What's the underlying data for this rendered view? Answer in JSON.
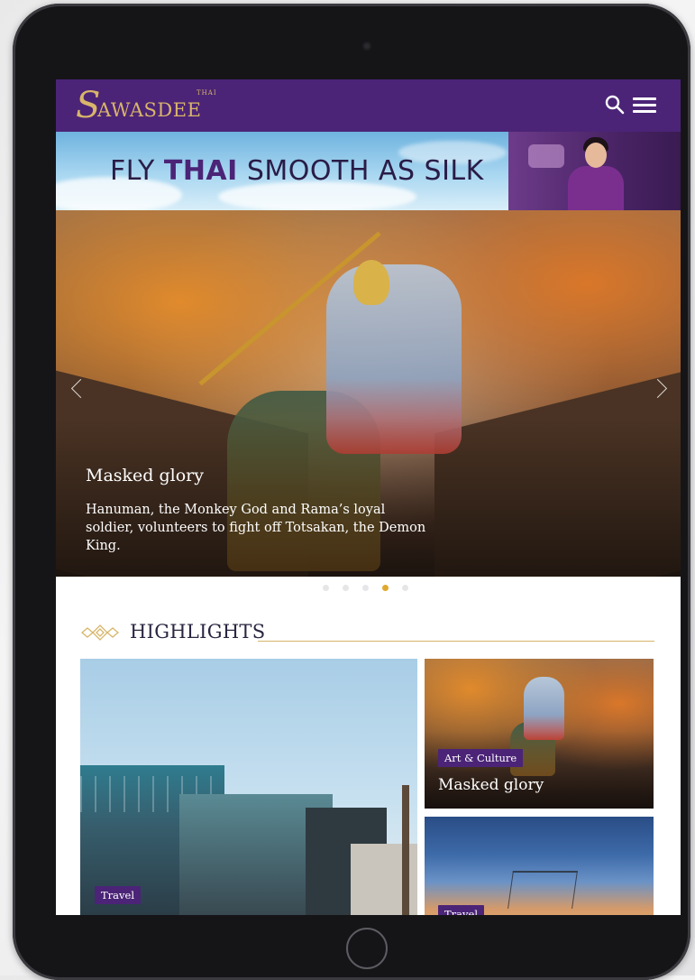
{
  "header": {
    "logo_initial": "S",
    "logo_text": "AWASDEE",
    "logo_tag": "THAI"
  },
  "banner": {
    "text_pre": "FLY ",
    "text_brand": "THAI",
    "text_post": " SMOOTH AS SILK"
  },
  "hero": {
    "title": "Masked glory",
    "description": "Hanuman, the Monkey God and Rama’s loyal soldier, volunteers to fight off Totsakan, the Demon King.",
    "slide_count": 5,
    "active_slide": 4
  },
  "highlights": {
    "heading": "HIGHLIGHTS",
    "cards": [
      {
        "tag": "Travel",
        "title": ""
      },
      {
        "tag": "Art & Culture",
        "title": "Masked glory"
      },
      {
        "tag": "Travel",
        "title": ""
      }
    ]
  },
  "colors": {
    "brand_purple": "#4b2477",
    "gold": "#d8b56a",
    "active_dot": "#e0a92e"
  }
}
